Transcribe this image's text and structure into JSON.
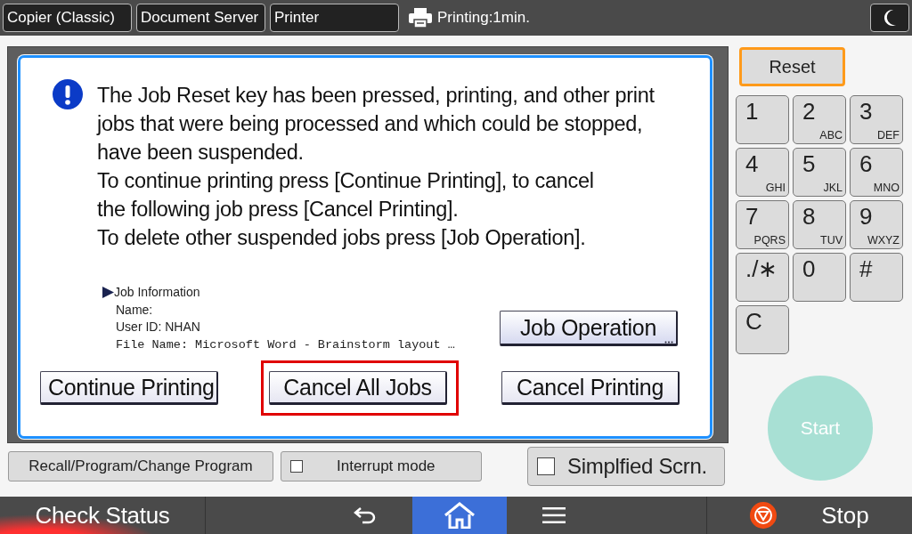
{
  "top_bar": {
    "tabs": [
      "Copier (Classic)",
      "Document Server",
      "Printer"
    ],
    "status": "Printing:1min."
  },
  "dialog": {
    "message": "The Job Reset key has been pressed, printing, and other print\njobs that were being processed and which could be stopped,\nhave been suspended.\nTo continue printing press [Continue Printing], to cancel\nthe following job press [Cancel Printing].\nTo delete other suspended jobs press [Job Operation].",
    "job_info_title": "Job Information",
    "job_info_lines": [
      "Name:",
      "User ID: NHAN",
      "File Name: Microsoft Word - Brainstorm layout …"
    ],
    "job_operation": "Job Operation",
    "buttons": [
      {
        "label": "Continue Printing",
        "highlighted": false
      },
      {
        "label": "Cancel All Jobs",
        "highlighted": true
      },
      {
        "label": "Cancel Printing",
        "highlighted": false
      }
    ]
  },
  "lower_buttons": [
    {
      "label": "Recall/Program/Change Program",
      "kind": "button"
    },
    {
      "label": "Interrupt mode",
      "kind": "checkbox",
      "checked": false
    }
  ],
  "simplified": {
    "label": "Simplfied Scrn.",
    "checked": false
  },
  "reset": "Reset",
  "keypad": [
    {
      "digit": "1"
    },
    {
      "digit": "2",
      "letters": "ABC"
    },
    {
      "digit": "3",
      "letters": "DEF"
    },
    {
      "digit": "4",
      "letters": "GHI"
    },
    {
      "digit": "5",
      "letters": "JKL"
    },
    {
      "digit": "6",
      "letters": "MNO"
    },
    {
      "digit": "7",
      "letters": "PQRS"
    },
    {
      "digit": "8",
      "letters": "TUV"
    },
    {
      "digit": "9",
      "letters": "WXYZ"
    },
    {
      "digit": "./∗"
    },
    {
      "digit": "0"
    },
    {
      "digit": "#"
    },
    {
      "digit": "C"
    }
  ],
  "start": {
    "label": "Start",
    "disabled": true
  },
  "bottom_bar": {
    "check_status": "Check Status",
    "nav": [
      {
        "kind": "back",
        "selected": false
      },
      {
        "kind": "home",
        "selected": true
      },
      {
        "kind": "menu",
        "selected": false
      }
    ],
    "stop": "Stop"
  }
}
